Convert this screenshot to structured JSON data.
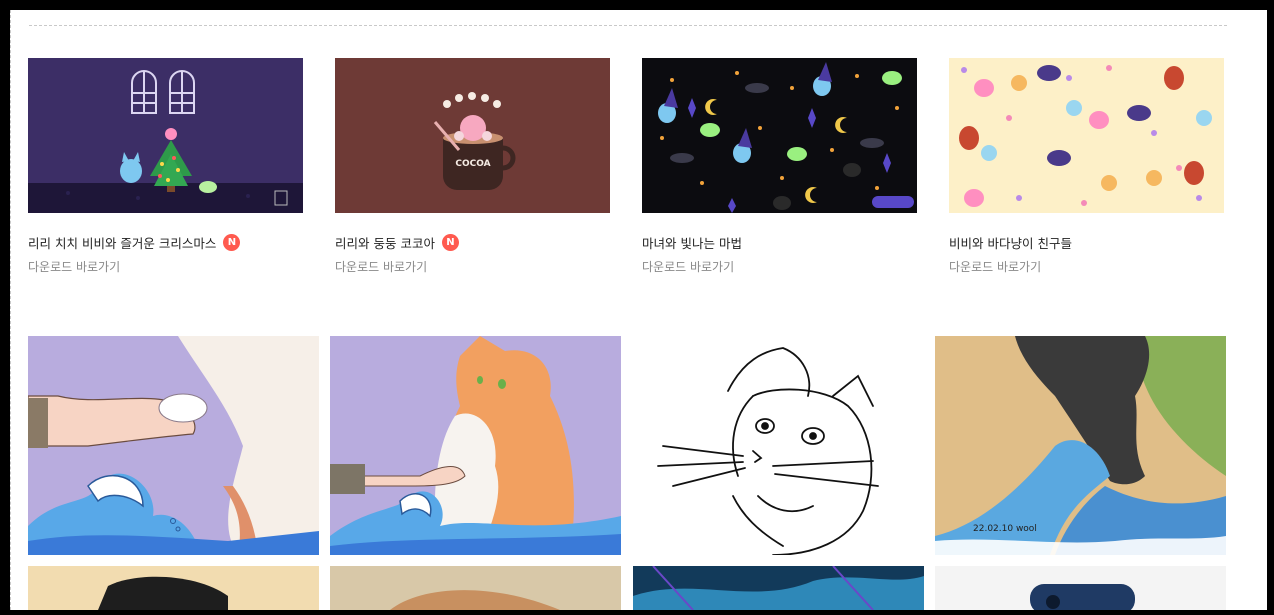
{
  "wallpapers": [
    {
      "title": "리리 치치 비비와 즐거운 크리스마스",
      "new_badge": "N",
      "download_label": "다운로드 바로가기"
    },
    {
      "title": "리리와 둥둥 코코아",
      "new_badge": "N",
      "download_label": "다운로드 바로가기",
      "artwork_text": "COCOA"
    },
    {
      "title": "마녀와 빛나는 마법",
      "download_label": "다운로드 바로가기"
    },
    {
      "title": "비비와 바다냥이 친구들",
      "download_label": "다운로드 바로가기"
    }
  ],
  "artworks": [
    {
      "subject": "hand-holding-cat-paw-over-wave"
    },
    {
      "subject": "orange-cat-handshake-over-wave"
    },
    {
      "subject": "cat-line-art"
    },
    {
      "subject": "black-cat-paw-on-wave",
      "signature": "22.02.10 wool"
    }
  ],
  "colors": {
    "badge": "#ff5a4f",
    "page_bg": "#ffffff",
    "frame": "#000000",
    "xmas_bg": "#3c2e66",
    "cocoa_bg": "#6e3a36",
    "witch_bg": "#0c0c10",
    "friends_bg": "#fdf0c8"
  }
}
